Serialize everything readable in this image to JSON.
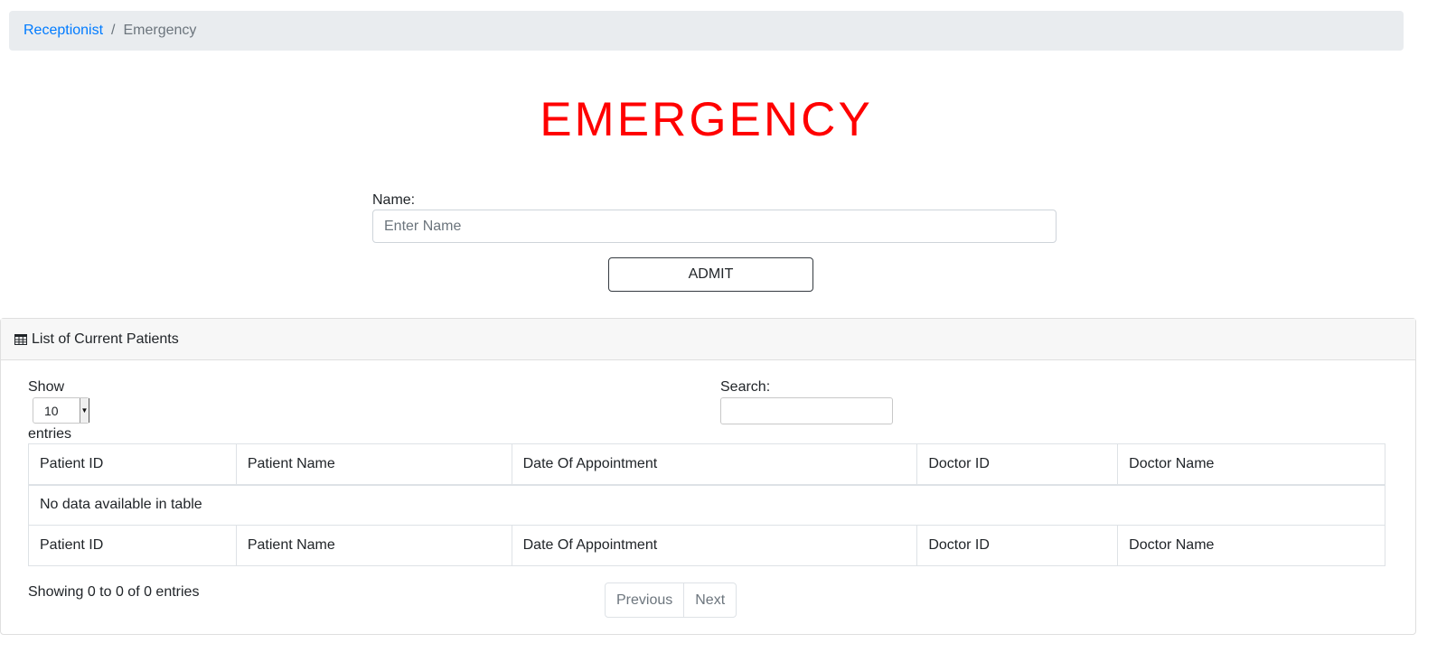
{
  "breadcrumb": {
    "parent": "Receptionist",
    "separator": "/",
    "current": "Emergency"
  },
  "title": "EMERGENCY",
  "form": {
    "name_label": "Name:",
    "name_placeholder": "Enter Name",
    "name_value": "",
    "admit_label": "ADMIT"
  },
  "card": {
    "header_icon": "table-icon",
    "header_title": "List of Current Patients",
    "show_label": "Show",
    "entries_value": "10",
    "entries_label": "entries",
    "search_label": "Search:",
    "search_value": "",
    "table": {
      "columns": [
        "Patient ID",
        "Patient Name",
        "Date Of Appointment",
        "Doctor ID",
        "Doctor Name"
      ],
      "empty_message": "No data available in table"
    },
    "info": "Showing 0 to 0 of 0 entries",
    "pagination": {
      "previous": "Previous",
      "next": "Next"
    }
  },
  "colors": {
    "title": "#ff0000",
    "link": "#007bff",
    "breadcrumb_bg": "#e9ecef"
  }
}
